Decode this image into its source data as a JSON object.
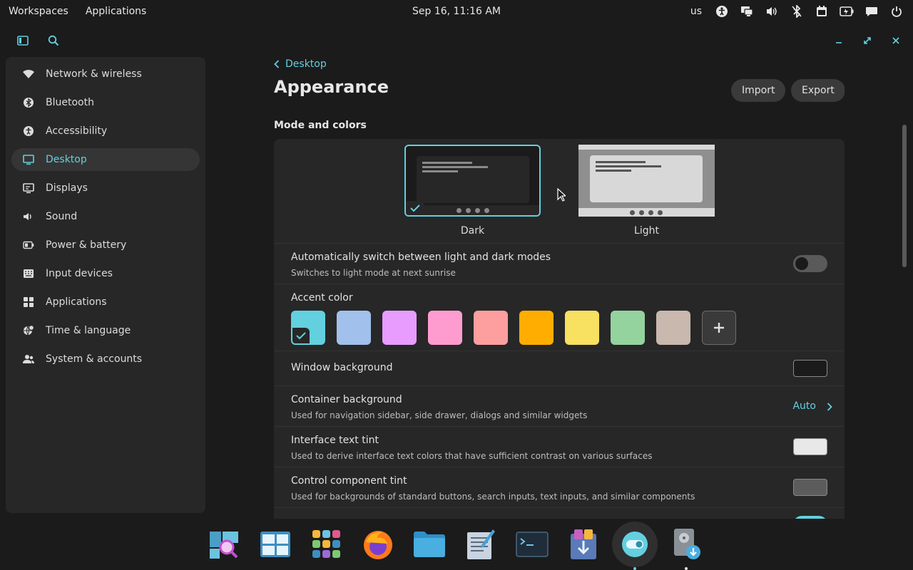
{
  "top_panel": {
    "workspaces": "Workspaces",
    "applications": "Applications",
    "clock": "Sep 16, 11:16 AM",
    "keyboard_layout": "us",
    "tray_icons": [
      "accessibility-icon",
      "display-icon",
      "volume-icon",
      "bluetooth-off-icon",
      "calendar-icon",
      "battery-icon",
      "notifications-icon",
      "power-icon"
    ]
  },
  "header": {
    "sidebar_toggle_icon": "sidebar-toggle-icon",
    "search_icon": "search-icon",
    "window_controls": [
      "minimize-icon",
      "maximize-icon",
      "close-icon"
    ]
  },
  "sidebar": {
    "items": [
      {
        "label": "Network & wireless",
        "icon": "wifi-icon"
      },
      {
        "label": "Bluetooth",
        "icon": "bluetooth-icon"
      },
      {
        "label": "Accessibility",
        "icon": "accessibility-icon"
      },
      {
        "label": "Desktop",
        "icon": "monitor-icon",
        "active": true
      },
      {
        "label": "Displays",
        "icon": "displays-icon"
      },
      {
        "label": "Sound",
        "icon": "speaker-icon"
      },
      {
        "label": "Power & battery",
        "icon": "battery-icon"
      },
      {
        "label": "Input devices",
        "icon": "keyboard-icon"
      },
      {
        "label": "Applications",
        "icon": "apps-grid-icon"
      },
      {
        "label": "Time & language",
        "icon": "globe-clock-icon"
      },
      {
        "label": "System & accounts",
        "icon": "users-icon"
      }
    ]
  },
  "main": {
    "breadcrumb": "Desktop",
    "title": "Appearance",
    "import_label": "Import",
    "export_label": "Export",
    "section_title": "Mode and colors",
    "modes": {
      "dark": {
        "label": "Dark",
        "selected": true
      },
      "light": {
        "label": "Light",
        "selected": false
      }
    },
    "auto_switch": {
      "title": "Automatically switch between light and dark modes",
      "subtitle": "Switches to light mode at next sunrise",
      "enabled": false
    },
    "accent": {
      "title": "Accent color",
      "colors": [
        "#63d0df",
        "#a1c0eb",
        "#e79cfe",
        "#ff9ccf",
        "#fd9f9e",
        "#ffad00",
        "#f8e061",
        "#94d39e",
        "#c8b8ae"
      ],
      "selected_index": 0
    },
    "window_background": {
      "title": "Window background",
      "color": "#1b1b1b"
    },
    "container_background": {
      "title": "Container background",
      "subtitle": "Used for navigation sidebar, side drawer, dialogs and similar widgets",
      "value": "Auto"
    },
    "interface_text_tint": {
      "title": "Interface text tint",
      "subtitle": "Used to derive interface text colors that have sufficient contrast on various surfaces",
      "color": "#e8e8e8"
    },
    "control_component_tint": {
      "title": "Control component tint",
      "subtitle": "Used for backgrounds of standard buttons, search inputs, text inputs, and similar components",
      "color": "#5c5c5c"
    }
  },
  "dock": {
    "items": [
      "launcher-search-icon",
      "workspaces-icon",
      "app-library-icon",
      "firefox-icon",
      "files-icon",
      "text-editor-icon",
      "terminal-icon",
      "store-icon",
      "settings-icon",
      "disk-installer-icon"
    ],
    "active_index": 8
  },
  "colors": {
    "accent": "#63d0df",
    "background": "#1b1b1b",
    "surface": "#272727"
  }
}
